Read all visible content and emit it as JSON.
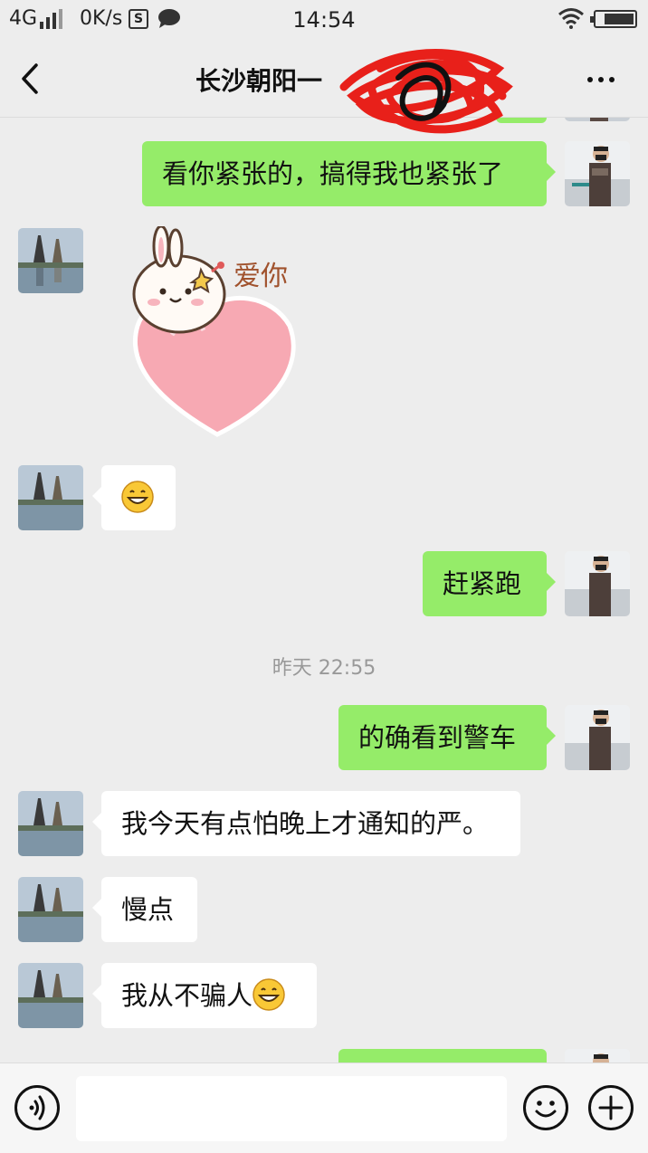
{
  "status_bar": {
    "network": "4G",
    "speed": "0K/s",
    "s_badge": "S",
    "time": "14:54",
    "battery_level": 0.8
  },
  "title_bar": {
    "title": "长沙朝阳一"
  },
  "messages": {
    "m1": {
      "text": "看你紧张的，搞得我也紧张了",
      "side": "sent"
    },
    "m2_sticker": {
      "text": "爱你",
      "side": "received"
    },
    "m3": {
      "emoji": "grinning-face",
      "side": "received"
    },
    "m4": {
      "text": "赶紧跑",
      "side": "sent"
    },
    "timestamp": "昨天 22:55",
    "m5": {
      "text": "的确看到警车",
      "side": "sent"
    },
    "m6": {
      "text": "我今天有点怕晚上才通知的严。",
      "side": "received"
    },
    "m7": {
      "text": "慢点",
      "side": "received"
    },
    "m8": {
      "text": "我从不骗人",
      "emoji": "grinning-face",
      "side": "received"
    }
  },
  "colors": {
    "sent_bubble": "#95ec69",
    "received_bubble": "#ffffff",
    "background": "#ededed"
  }
}
